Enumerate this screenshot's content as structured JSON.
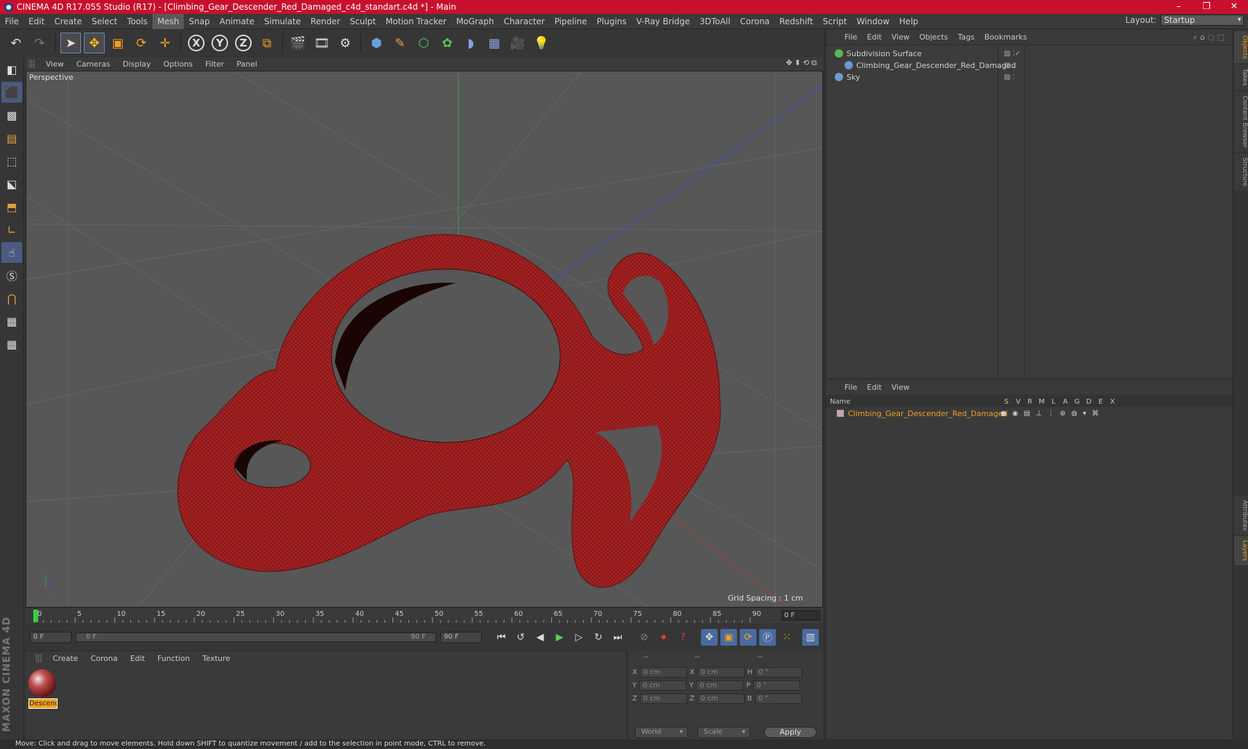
{
  "window": {
    "title": "CINEMA 4D R17.055 Studio (R17) - [Climbing_Gear_Descender_Red_Damaged_c4d_standart.c4d *] - Main",
    "controls": [
      "–",
      "❐",
      "✕"
    ]
  },
  "menubar": {
    "items": [
      "File",
      "Edit",
      "Create",
      "Select",
      "Tools",
      "Mesh",
      "Snap",
      "Animate",
      "Simulate",
      "Render",
      "Sculpt",
      "Motion Tracker",
      "MoGraph",
      "Character",
      "Pipeline",
      "Plugins",
      "V-Ray Bridge",
      "3DToAll",
      "Corona",
      "Redshift",
      "Script",
      "Window",
      "Help"
    ],
    "active": "Mesh",
    "layout_label": "Layout:",
    "layout_value": "Startup"
  },
  "toolbar": {
    "axis_labels": [
      "X",
      "Y",
      "Z"
    ]
  },
  "viewport": {
    "menu": [
      "View",
      "Cameras",
      "Display",
      "Options",
      "Filter",
      "Panel"
    ],
    "label": "Perspective",
    "grid_spacing": "Grid Spacing : 1 cm",
    "colors": {
      "background": "#575757",
      "object": "#8b1a1a",
      "grid": "#6a6a6a"
    }
  },
  "timeline": {
    "ticks": [
      "0",
      "5",
      "10",
      "15",
      "20",
      "25",
      "30",
      "35",
      "40",
      "45",
      "50",
      "55",
      "60",
      "65",
      "70",
      "75",
      "80",
      "85",
      "90"
    ],
    "current_frame_display": "0 F"
  },
  "transport": {
    "start_field": "0 F",
    "range_start": "0 F",
    "range_end": "90 F",
    "end_field": "90 F"
  },
  "material_panel": {
    "menu": [
      "Create",
      "Corona",
      "Edit",
      "Function",
      "Texture"
    ],
    "material_name": "Descenc"
  },
  "coordinates": {
    "header": [
      "--",
      "--",
      "--"
    ],
    "rows": [
      {
        "a": "X",
        "av": "0 cm",
        "b": "X",
        "bv": "0 cm",
        "c": "H",
        "cv": "0 °"
      },
      {
        "a": "Y",
        "av": "0 cm",
        "b": "Y",
        "bv": "0 cm",
        "c": "P",
        "cv": "0 °"
      },
      {
        "a": "Z",
        "av": "0 cm",
        "b": "Z",
        "bv": "0 cm",
        "c": "B",
        "cv": "0 °"
      }
    ],
    "mode_world": "World",
    "mode_scale": "Scale",
    "apply": "Apply"
  },
  "object_manager": {
    "menu": [
      "File",
      "Edit",
      "View",
      "Objects",
      "Tags",
      "Bookmarks"
    ],
    "objects": [
      {
        "name": "Subdivision Surface",
        "indent": 0,
        "color": "#5ab85a"
      },
      {
        "name": "Climbing_Gear_Descender_Red_Damaged",
        "indent": 1,
        "color": "#6a9ad0"
      },
      {
        "name": "Sky",
        "indent": 0,
        "color": "#6a9ad0"
      }
    ]
  },
  "layer_manager": {
    "menu": [
      "File",
      "Edit",
      "View"
    ],
    "header_name": "Name",
    "header_cols": [
      "S",
      "V",
      "R",
      "M",
      "L",
      "A",
      "G",
      "D",
      "E",
      "X"
    ],
    "layer_name": "Climbing_Gear_Descender_Red_Damaged"
  },
  "right_tabs": [
    "Objects",
    "Takes",
    "Content Browser",
    "Structure",
    "Attributes",
    "Layers"
  ],
  "status": "Move: Click and drag to move elements. Hold down SHIFT to quantize movement / add to the selection in point mode, CTRL to remove."
}
